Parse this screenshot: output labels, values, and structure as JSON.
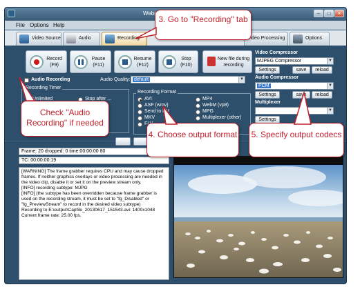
{
  "window": {
    "title": "Webcam/Screen Recorder",
    "buttons": {
      "minimize": "–",
      "maximize": "□",
      "close": "×"
    }
  },
  "menu": [
    "File",
    "Options",
    "Help"
  ],
  "tabs": [
    {
      "label": "Video Source",
      "icon": "video-source-icon"
    },
    {
      "label": "Audio",
      "icon": "microphone-icon"
    },
    {
      "label": "Recording",
      "icon": "recording-folder-icon",
      "active": true
    },
    {
      "label": "Video Processing",
      "icon": "video-processing-icon"
    },
    {
      "label": "Options",
      "icon": "tools-icon"
    }
  ],
  "controls": {
    "record": {
      "label": "Record",
      "key": "(F9)"
    },
    "pause": {
      "label": "Pause",
      "key": "(F11)"
    },
    "resume": {
      "label": "Resume",
      "key": "(F12)"
    },
    "stop": {
      "label": "Stop",
      "key": "(F10)"
    },
    "newfile": {
      "label1": "New file during",
      "label2": "recording"
    }
  },
  "audio_recording": {
    "label": "Audio Recording",
    "quality_label": "Audio Quality:",
    "quality_value": "default"
  },
  "recording_timer": {
    "label": "Recording Timer",
    "opt1": "Unlimited",
    "opt2": "Stop after ..."
  },
  "recording_format": {
    "label": "Recording Format",
    "options_left": [
      "AVI",
      "ASF (wmv)",
      "Send to DV",
      "MKV",
      "FLV"
    ],
    "options_right": [
      "MP4",
      "WebM (vp8)",
      "MPG",
      "Multiplexer (other)"
    ],
    "selected": "AVI"
  },
  "video_compressor": {
    "label": "Video Compressor",
    "value": "MJPEG Compressor",
    "btn_settings": "Settings",
    "btn_save": "save",
    "btn_reload": "reload"
  },
  "audio_compressor": {
    "label": "Audio Compressor",
    "value": "PCM",
    "btn_settings": "Settings",
    "btn_save": "save",
    "btn_reload": "reload"
  },
  "multiplexer": {
    "label": "Multiplexer",
    "value": "",
    "btn_settings": "Settings"
  },
  "status": {
    "frames": "Frame: 20 dropped: 0 time:00:00:00 80",
    "tc": "TC: 00:00:00:19"
  },
  "log_lines": [
    "[WARNING] The frame grabber requires CPU and may cause dropped frames. If neither graphics overlays or video processing are needed in the video clip, disable it or set it on the preview stream only.",
    "[INFO] recording subtype: MJPG",
    "[INFO] (the subtype has been overridden because frame grabber is used on the recording stream, it must be set to \"fg_Disabled\" or \"fg_PreviewStream\" to record in the desired video subtype)",
    "Recording to E:\\output\\Capfile_20130617_151543.avi: 1400x1048",
    "Current frame rate: 25.00 fps."
  ],
  "callouts": {
    "c3": "3. Go to \"Recording\" tab",
    "c_audio": "Check \"Audio Recording\" if needed",
    "c4": "4. Choose output format",
    "c5": "5. Specify output codecs"
  },
  "colors": {
    "callout_border": "#c0202a",
    "window_bg": "#3d5f7c",
    "panel_bg": "#2e4f6b"
  }
}
